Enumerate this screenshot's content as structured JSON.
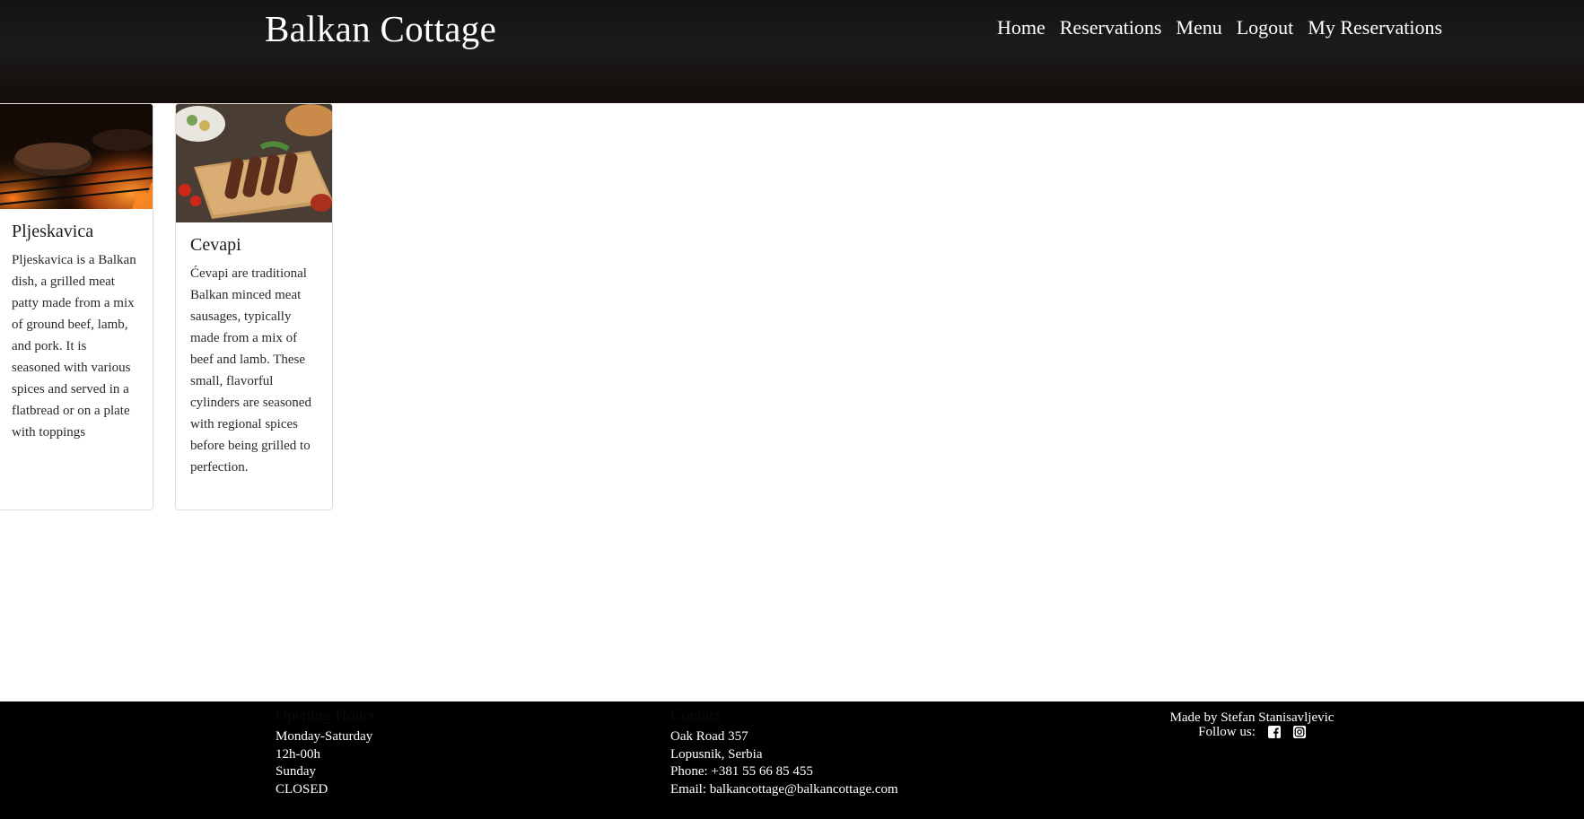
{
  "header": {
    "brand": "Balkan Cottage",
    "nav": [
      "Home",
      "Reservations",
      "Menu",
      "Logout",
      "My Reservations"
    ]
  },
  "menu_items": [
    {
      "title": "Pljeskavica",
      "description": "Pljeskavica is a Balkan dish, a grilled meat patty made from a mix of ground beef, lamb, and pork. It is seasoned with various spices and served in a flatbread or on a plate with toppings",
      "image": "grilled-patty-photo"
    },
    {
      "title": "Cevapi",
      "description": "Ćevapi are traditional Balkan minced meat sausages, typically made from a mix of beef and lamb. These small, flavorful cylinders are seasoned with regional spices before being grilled to perfection.",
      "image": "cevapi-platter-photo"
    }
  ],
  "footer": {
    "hours": {
      "heading": "Opening Hours",
      "lines": [
        "Monday-Saturday",
        "12h-00h",
        "Sunday",
        "CLOSED"
      ]
    },
    "contact": {
      "heading": "Contact",
      "lines": [
        "Oak Road 357",
        "Lopusnik, Serbia",
        "Phone: +381 55 66 85 455",
        "Email: balkancottage@balkancottage.com"
      ]
    },
    "credits": {
      "made_by": "Made by Stefan Stanisavljevic",
      "follow_label": "Follow us:",
      "icons": [
        "facebook-icon",
        "instagram-icon"
      ]
    }
  },
  "colors": {
    "header_bg": "#151515",
    "footer_bg": "#000000",
    "text_light": "#ffffff",
    "card_border": "#dcdcdc"
  }
}
